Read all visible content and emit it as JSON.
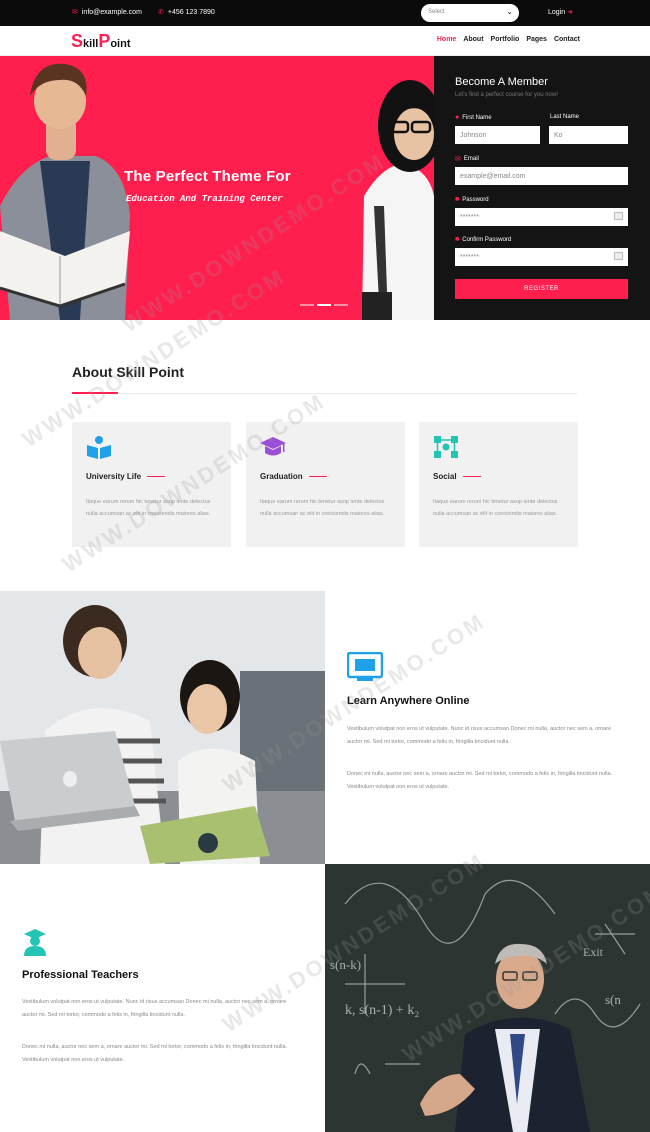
{
  "topbar": {
    "email": "info@example.com",
    "phone": "+456 123 7890",
    "select_label": "Select",
    "login_label": "Login"
  },
  "brand": {
    "logo_big_s": "S",
    "logo_mid": "kill",
    "logo_big_p": "P",
    "logo_end": "oint"
  },
  "nav": {
    "items": [
      "Home",
      "About",
      "Portfolio",
      "Pages",
      "Contact"
    ],
    "active": "Home"
  },
  "hero": {
    "title": "The Perfect Theme For",
    "subtitle": "Education And Training Center"
  },
  "form": {
    "title": "Become A Member",
    "hint": "Let's find a perfect course for you now!",
    "first_name_label": "First Name",
    "first_name_value": "Johnson",
    "last_name_label": "Last Name",
    "last_name_value": "Ko",
    "email_label": "Email",
    "email_value": "example@email.com",
    "password_label": "Password",
    "password_value": "*******",
    "confirm_label": "Confirm Password",
    "confirm_value": "*******",
    "register_label": "REGISTER"
  },
  "about": {
    "title": "About Skill Point",
    "cards": [
      {
        "title": "University Life",
        "text": "Itaque earum rerum hic tenetur asop iente delectus nulla accumsan ac elit in coeiciendis maiores alias.",
        "icon": "book-reader-icon",
        "color": "#1ea1e8"
      },
      {
        "title": "Graduation",
        "text": "Itaque earum rerum hic tenetur asop iente delectus nulla accumsan ac elit in coeiciendis maiores alias.",
        "icon": "graduation-cap-icon",
        "color": "#9b4fd6"
      },
      {
        "title": "Social",
        "text": "Itaque earum rerum hic tenetur asop iente delectus nulla accumsan ac elit in coeiciendis maiores alias.",
        "icon": "network-icon",
        "color": "#23c4b4"
      }
    ]
  },
  "learn": {
    "title": "Learn Anywhere Online",
    "p1": "Vestibulum volutpat non eros ut vulputate. Nunc id risus accumsan Donec mi nulla, auctor nec sem a, ornare auctor mi. Sed mi tortor, commodo a felis in, fringilla tincidunt nulla.",
    "p2": "Donec mi nulla, auctor nec sem a, ornare auctor mi. Sed mi tortor, commodo a felis in, fringilla tincidunt nulla. Vestibulum volutpat non eros ut vulputate.",
    "icon": "monitor-icon",
    "color": "#1ea1e8"
  },
  "teachers": {
    "title": "Professional Teachers",
    "p1": "Vestibulum volutpat non eros ut vulputate. Nunc id risus accumsan Donec mi nulla, auctor nec sem a, ornare auctor mi. Sed mi tortor, commodo a felis in, fringilla tincidunt nulla.",
    "p2": "Donec mi nulla, auctor nec sem a, ornare auctor mi. Sed mi tortor, commodo a felis in, fringilla tincidunt nulla. Vestibulum volutpat non eros ut vulputate.",
    "icon": "teacher-icon",
    "color": "#23c4b4"
  },
  "watermark": "WWW.DOWNDEMO.COM",
  "colors": {
    "accent": "#ff1f4f",
    "dark": "#141414"
  }
}
